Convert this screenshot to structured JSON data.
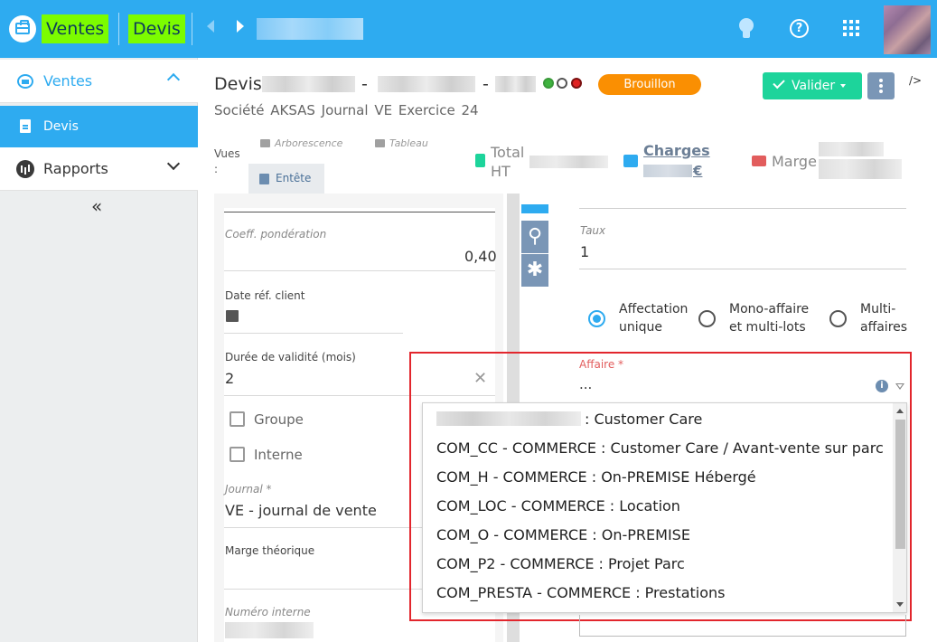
{
  "topbar": {
    "tabs": [
      "Ventes",
      "Devis"
    ],
    "icons": [
      "briefcase-icon",
      "arrow-left-icon",
      "arrow-right-icon",
      "lightbulb-icon",
      "help-icon",
      "apps-grid-icon",
      "avatar"
    ],
    "colors": {
      "bar": "#2eabf0",
      "highlight": "#7cfc00"
    }
  },
  "sidebar": {
    "items": [
      {
        "label": "Ventes",
        "icon": "briefcase-icon"
      },
      {
        "label": "Devis",
        "icon": "document-icon"
      },
      {
        "label": "Rapports",
        "icon": "chart-icon"
      }
    ],
    "collapse": "«"
  },
  "header": {
    "title": "Devis",
    "dash1": "-",
    "dash2": "-",
    "status_badge": "Brouillon",
    "status_color": "#fa8f02",
    "validate_label": "Valider",
    "close_tag": "/>",
    "subtitle": "Société AKSAS   Journal VE   Exercice 24"
  },
  "views": {
    "label": "Vues :",
    "tree": "Arborescence",
    "table": "Tableau",
    "header": "Entête"
  },
  "stats": {
    "total_label": "Total HT",
    "charges_label": "Charges",
    "charges_suffix": "€",
    "marge_label": "Marge"
  },
  "left_form": {
    "coeff_label": "Coeff. pondération",
    "coeff_value": "0,40",
    "date_label": "Date réf. client",
    "validity_label": "Durée de validité (mois)",
    "validity_value": "2",
    "groupe_label": "Groupe",
    "interne_label": "Interne",
    "journal_label": "Journal *",
    "journal_value": "VE - journal de vente",
    "marge_label": "Marge théorique",
    "num_label": "Numéro interne"
  },
  "right_form": {
    "taux_label": "Taux",
    "taux_value": "1",
    "radios": [
      "Affectation unique",
      "Mono-affaire et multi-lots",
      "Multi-affaires"
    ],
    "affaire_label": "Affaire *",
    "affaire_value": "..."
  },
  "dropdown": {
    "first_suffix": ": Customer Care",
    "options": [
      "COM_CC - COMMERCE : Customer Care / Avant-vente sur parc",
      "COM_H - COMMERCE : On-PREMISE Hébergé",
      "COM_LOC - COMMERCE : Location",
      "COM_O - COMMERCE : On-PREMISE",
      "COM_P2 - COMMERCE : Projet Parc",
      "COM_PRESTA - COMMERCE : Prestations"
    ]
  }
}
